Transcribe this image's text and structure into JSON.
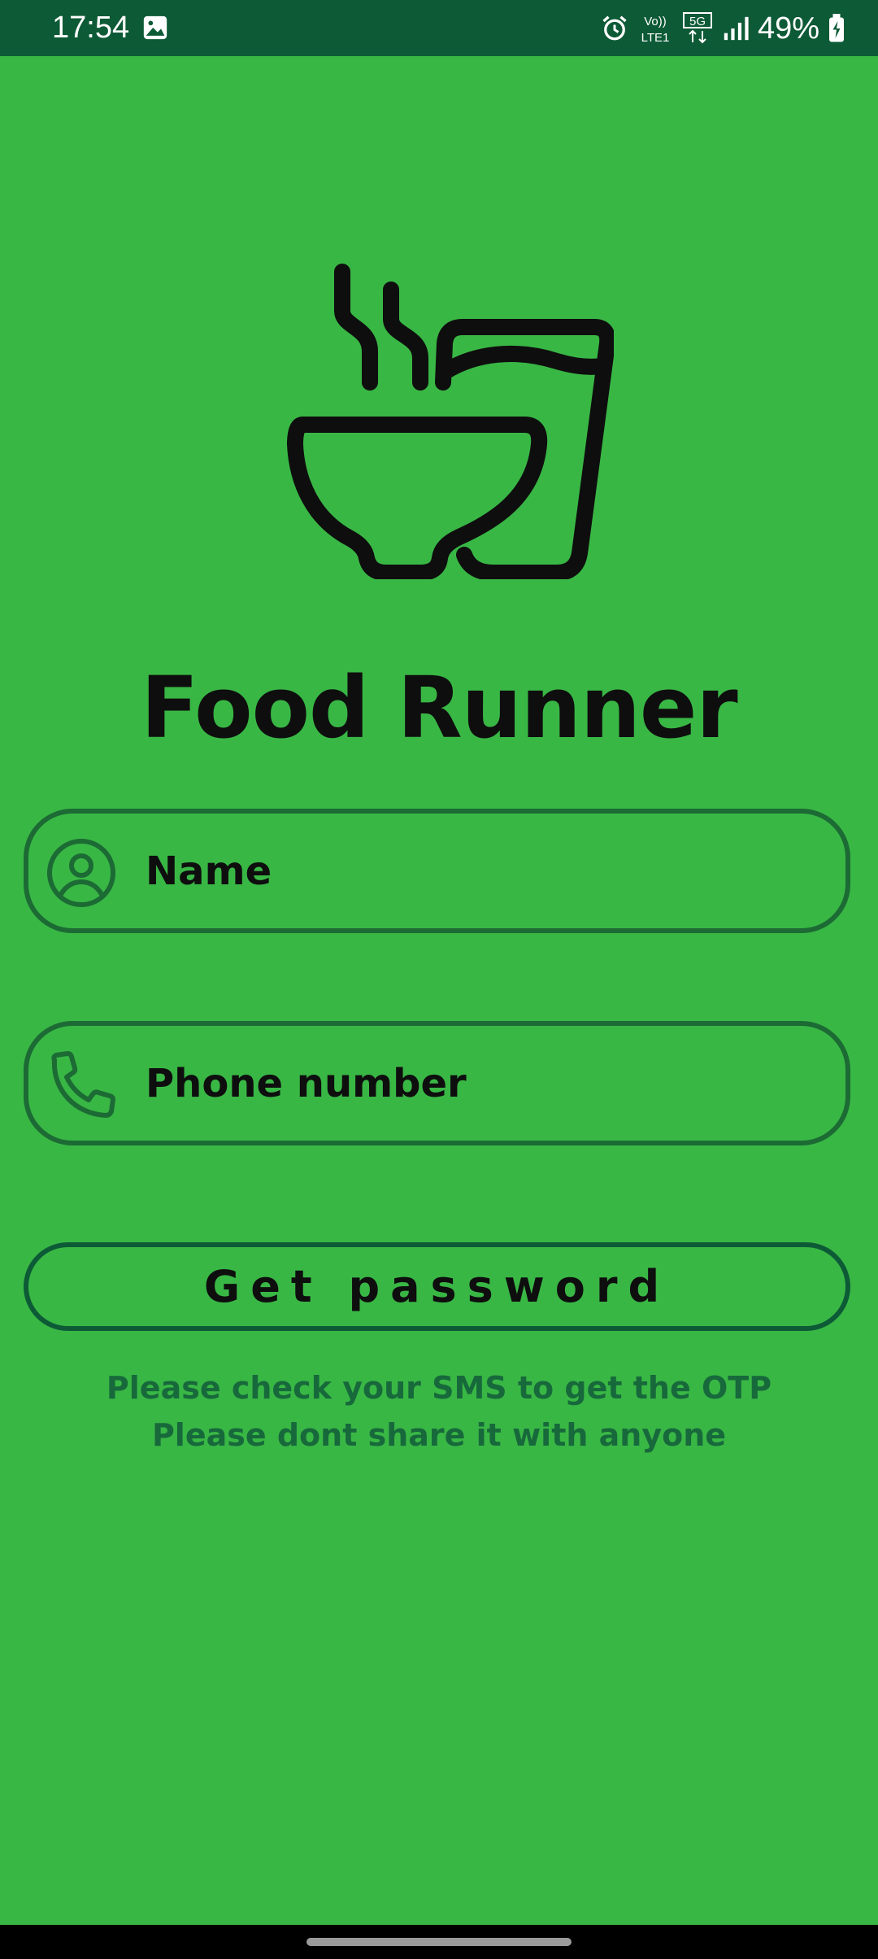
{
  "status_bar": {
    "time": "17:54",
    "battery_percent": "49%",
    "icons": [
      "gallery-icon",
      "alarm-icon",
      "volte-icon",
      "5g-icon",
      "signal-icon",
      "battery-charging-icon"
    ],
    "volte_label": "Vo))",
    "lte_label": "LTE1",
    "network_label": "5G"
  },
  "app": {
    "title": "Food Runner",
    "logo_icon": "bowl-and-glass-icon"
  },
  "form": {
    "name_placeholder": "Name",
    "name_icon": "user-circle-icon",
    "phone_placeholder": "Phone number",
    "phone_icon": "phone-icon",
    "submit_label": "Get password"
  },
  "hints": {
    "line1": "Please check your SMS to get the OTP",
    "line2": "Please dont share it with anyone"
  },
  "colors": {
    "background": "#39b745",
    "status_bar": "#0d5a36",
    "border": "#1c6a34",
    "hint_text": "#17693b"
  }
}
